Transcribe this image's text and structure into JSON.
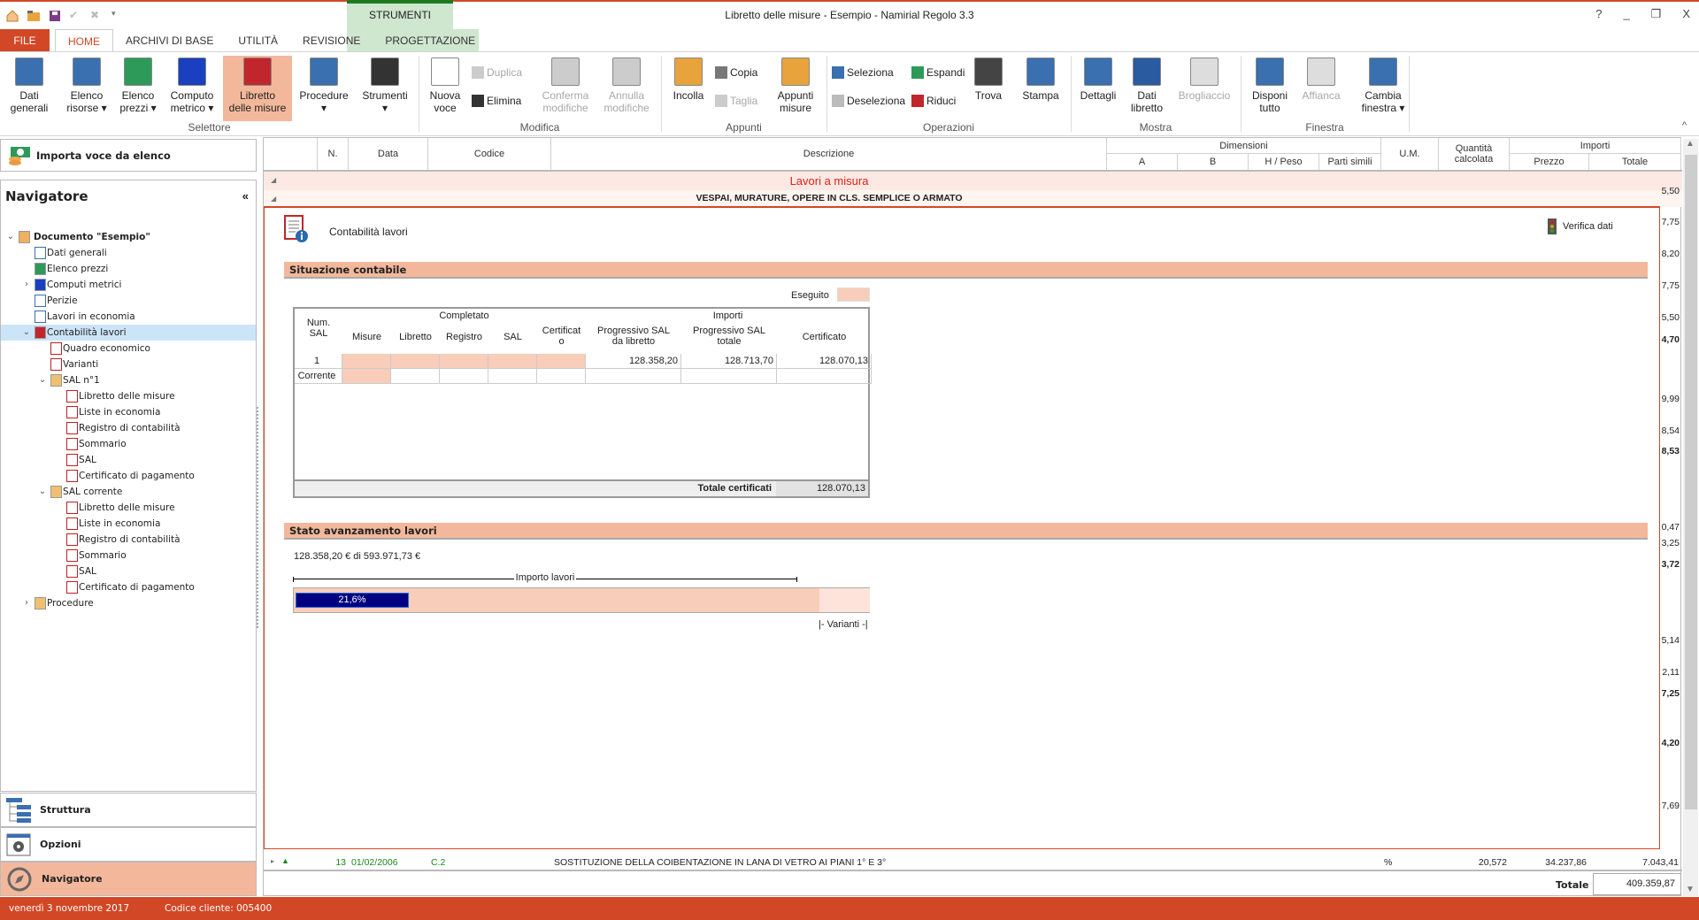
{
  "window": {
    "title": "Libretto delle misure - Esempio - Namirial Regolo 3.3",
    "context_tab_group": "STRUMENTI",
    "help": "?",
    "minimize": "_",
    "restore": "❐",
    "close": "X"
  },
  "tabs": [
    "FILE",
    "HOME",
    "ARCHIVI DI BASE",
    "UTILITÀ",
    "REVISIONE",
    "PROGETTAZIONE"
  ],
  "ribbon": {
    "groups": [
      "Selettore",
      "Modifica",
      "Appunti",
      "Operazioni",
      "Mostra",
      "Finestra"
    ],
    "buttons": {
      "dati_generali": "Dati\ngenerali",
      "elenco_risorse": "Elenco\nrisorse ▾",
      "elenco_prezzi": "Elenco\nprezzi ▾",
      "computo_metrico": "Computo\nmetrico ▾",
      "libretto": "Libretto\ndelle misure",
      "procedure": "Procedure\n▾",
      "strumenti": "Strumenti\n▾",
      "nuova_voce": "Nuova\nvoce",
      "duplica": "Duplica",
      "elimina": "Elimina",
      "conferma": "Conferma\nmodifiche",
      "annulla": "Annulla\nmodifiche",
      "incolla": "Incolla",
      "copia": "Copia",
      "taglia": "Taglia",
      "appunti_misure": "Appunti\nmisure",
      "seleziona": "Seleziona",
      "deseleziona": "Deseleziona",
      "espandi": "Espandi",
      "riduci": "Riduci",
      "trova": "Trova",
      "stampa": "Stampa",
      "dettagli": "Dettagli",
      "dati_libretto": "Dati\nlibretto",
      "brogliaccio": "Brogliaccio",
      "disponi": "Disponi\ntutto",
      "affianca": "Affianca",
      "cambia": "Cambia\nfinestra ▾"
    },
    "collapse": "^"
  },
  "left": {
    "import_label": "Importa voce da elenco",
    "nav_title": "Navigatore",
    "nav_collapse": "«",
    "tree": [
      {
        "label": "Documento \"Esempio\"",
        "level": 0,
        "exp": "open",
        "icon": "database",
        "bold": true
      },
      {
        "label": "Dati generali",
        "level": 1,
        "icon": "doc-blue"
      },
      {
        "label": "Elenco prezzi",
        "level": 1,
        "icon": "money"
      },
      {
        "label": "Computi metrici",
        "level": 1,
        "exp": "closed",
        "icon": "computo"
      },
      {
        "label": "Perizie",
        "level": 1,
        "icon": "doc-blue"
      },
      {
        "label": "Lavori in economia",
        "level": 1,
        "icon": "doc-blue"
      },
      {
        "label": "Contabilità lavori",
        "level": 1,
        "exp": "open",
        "icon": "libretto",
        "selected": true
      },
      {
        "label": "Quadro economico",
        "level": 2,
        "icon": "doc-red"
      },
      {
        "label": "Varianti",
        "level": 2,
        "icon": "doc-red"
      },
      {
        "label": "SAL n°1",
        "level": 2,
        "exp": "open",
        "icon": "folder"
      },
      {
        "label": "Libretto delle misure",
        "level": 3,
        "icon": "doc-red-check"
      },
      {
        "label": "Liste in economia",
        "level": 3,
        "icon": "doc-red-check"
      },
      {
        "label": "Registro di contabilità",
        "level": 3,
        "icon": "doc-red-check"
      },
      {
        "label": "Sommario",
        "level": 3,
        "icon": "doc-red-check"
      },
      {
        "label": "SAL",
        "level": 3,
        "icon": "doc-red-check"
      },
      {
        "label": "Certificato di pagamento",
        "level": 3,
        "icon": "doc-red-check"
      },
      {
        "label": "SAL corrente",
        "level": 2,
        "exp": "open",
        "icon": "folder"
      },
      {
        "label": "Libretto delle misure",
        "level": 3,
        "icon": "doc-red"
      },
      {
        "label": "Liste in economia",
        "level": 3,
        "icon": "doc-red"
      },
      {
        "label": "Registro di contabilità",
        "level": 3,
        "icon": "doc-red"
      },
      {
        "label": "Sommario",
        "level": 3,
        "icon": "doc-red"
      },
      {
        "label": "SAL",
        "level": 3,
        "icon": "doc-red"
      },
      {
        "label": "Certificato di pagamento",
        "level": 3,
        "icon": "doc-red"
      },
      {
        "label": "Procedure",
        "level": 1,
        "exp": "closed",
        "icon": "folder"
      }
    ],
    "bottom_buttons": [
      "Struttura",
      "Opzioni",
      "Navigatore"
    ]
  },
  "status": {
    "date": "venerdì 3 novembre 2017",
    "client": "Codice cliente: 005400"
  },
  "grid": {
    "headers": {
      "n": "N.",
      "data": "Data",
      "codice": "Codice",
      "descrizione": "Descrizione",
      "dimensioni": "Dimensioni",
      "a": "A",
      "b": "B",
      "h": "H / Peso",
      "parti": "Parti simili",
      "um": "U.M.",
      "quantita": "Quantità calcolata",
      "importi": "Importi",
      "prezzo": "Prezzo",
      "totale": "Totale"
    },
    "row_category": "Lavori a misura",
    "row_subcategory": "VESPAI, MURATURE, OPERE IN CLS. SEMPLICE O ARMATO",
    "right_partial_values": [
      "5,50",
      "7,75",
      "8,20",
      "7,75",
      "5,50",
      "4,70",
      "9,99",
      "8,54",
      "8,53",
      "0,47",
      "3,25",
      "3,72",
      "5,14",
      "2,11",
      "7,25",
      "4,20",
      "7,69"
    ],
    "bottom_row": {
      "n": "13",
      "data": "01/02/2006",
      "codice": "C.2",
      "descrizione": "SOSTITUZIONE DELLA COIBENTAZIONE IN LANA DI VETRO AI PIANI 1° E 3°",
      "um": "%",
      "quantita": "20,572",
      "prezzo": "34.237,86",
      "totale": "7.043,41"
    },
    "totale_label": "Totale",
    "totale_value": "409.359,87"
  },
  "panel": {
    "title": "Contabilità lavori",
    "verifica": "Verifica dati",
    "situazione": "Situazione contabile",
    "eseguito": "Eseguito",
    "table": {
      "h_num": "Num.\nSAL",
      "h_completato": "Completato",
      "h_importi": "Importi",
      "cols": [
        "Misure",
        "Libretto",
        "Registro",
        "SAL",
        "Certificat\no",
        "Progressivo SAL\nda libretto",
        "Progressivo SAL\ntotale",
        "Certificato"
      ],
      "rows": [
        {
          "num": "1",
          "prog_libretto": "128.358,20",
          "prog_totale": "128.713,70",
          "certificato": "128.070,13"
        },
        {
          "num": "Corrente",
          "prog_libretto": "",
          "prog_totale": "",
          "certificato": ""
        }
      ],
      "totale_label": "Totale certificati",
      "totale_value": "128.070,13"
    },
    "stato": "Stato avanzamento lavori",
    "amount_text": "128.358,20 € di 593.971,73 €",
    "importo_lavori": "Importo lavori",
    "progress_percent": 21.6,
    "progress_label": "21,6%",
    "varianti": "Varianti"
  },
  "colors": {
    "accent": "#d24726",
    "section": "#f3b89b",
    "pink": "#f8cdb9",
    "progress": "#000080",
    "selection": "#cce4f7"
  }
}
